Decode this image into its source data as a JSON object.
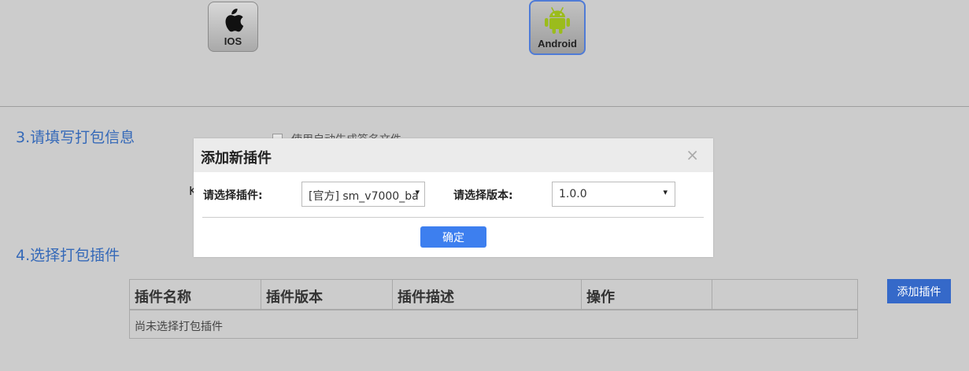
{
  "platforms": {
    "ios_label": "IOS",
    "android_label": "Android",
    "selected": "Android"
  },
  "sections": {
    "pack_info_title": "3.请填写打包信息",
    "auto_sign_label": "使用自动生成签名文件",
    "partial_k": "K",
    "plugins_title": "4.选择打包插件"
  },
  "plugin_table": {
    "columns": [
      "插件名称",
      "插件版本",
      "插件描述",
      "操作",
      ""
    ],
    "empty_text": "尚未选择打包插件"
  },
  "add_plugin_button": "添加插件",
  "dialog": {
    "title": "添加新插件",
    "close": "×",
    "plugin_label": "请选择插件:",
    "plugin_value": "[官方] sm_v7000_ba",
    "version_label": "请选择版本:",
    "version_value": "1.0.0",
    "confirm": "确定"
  },
  "colors": {
    "accent": "#3569c9",
    "confirm": "#3d7fef",
    "section_title": "#3569b8",
    "android_green": "#9bbc1c",
    "background": "#cccccc"
  }
}
